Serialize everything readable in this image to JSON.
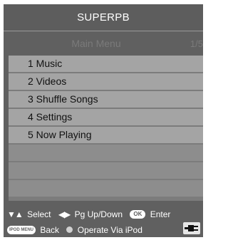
{
  "window": {
    "title": "SUPERPB"
  },
  "menu": {
    "title": "Main Menu",
    "page_indicator": "1/5",
    "items": [
      {
        "label": "1 Music"
      },
      {
        "label": "2 Videos"
      },
      {
        "label": "3 Shuffle Songs"
      },
      {
        "label": "4 Settings"
      },
      {
        "label": "5 Now Playing"
      }
    ],
    "empty_rows": 3
  },
  "help": {
    "select_label": "Select",
    "page_label": "Pg Up/Down",
    "ok_key": "OK",
    "enter_label": "Enter",
    "menu_key": "IPOD MENU",
    "back_label": "Back",
    "operate_label": "Operate Via iPod"
  },
  "icons": {
    "select": "up-down-arrows-icon",
    "page": "left-right-arrows-icon",
    "ok": "ok-button-icon",
    "menu": "ipod-menu-button-icon",
    "operate": "dot-icon",
    "power": "power-plug-icon"
  }
}
